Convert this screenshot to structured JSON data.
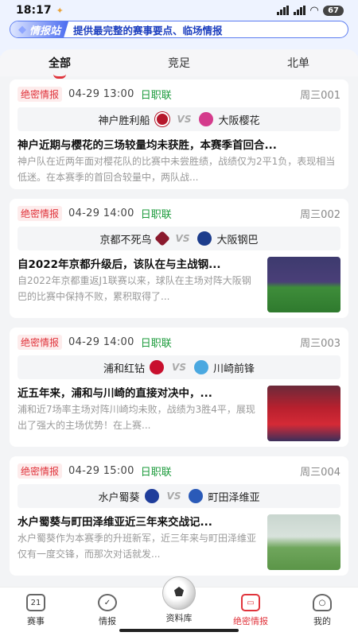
{
  "status": {
    "time": "18:17",
    "battery": "67"
  },
  "banner": {
    "badge": "情报站",
    "text": "提供最完整的赛事要点、临场情报"
  },
  "tabs": [
    "全部",
    "竞足",
    "北单"
  ],
  "colors": {
    "accent": "#e0343c",
    "league": "#1a9a3a"
  },
  "cards": [
    {
      "tag": "绝密情报",
      "time": "04-29 13:00",
      "league": "日职联",
      "code": "周三001",
      "home": "神户胜利船",
      "away": "大阪樱花",
      "vs": "VS",
      "title": "神户近期与樱花的三场较量均未获胜，本赛季首回合...",
      "desc": "神户队在近两年面对樱花队的比赛中未尝胜绩，战绩仅为2平1负，表现相当低迷。在本赛季的首回合较量中，两队战..."
    },
    {
      "tag": "绝密情报",
      "time": "04-29 14:00",
      "league": "日职联",
      "code": "周三002",
      "home": "京都不死鸟",
      "away": "大阪钢巴",
      "vs": "VS",
      "title": "自2022年京都升级后，该队在与主战钢...",
      "desc": "自2022年京都重返J1联赛以来，球队在主场对阵大阪钢巴的比赛中保持不败，累积取得了..."
    },
    {
      "tag": "绝密情报",
      "time": "04-29 14:00",
      "league": "日职联",
      "code": "周三003",
      "home": "浦和红钻",
      "away": "川崎前锋",
      "vs": "VS",
      "title": "近五年来，浦和与川崎的直接对决中，...",
      "desc": "浦和近7场率主场对阵川崎均未败，战绩为3胜4平，展现出了强大的主场优势！在上赛..."
    },
    {
      "tag": "绝密情报",
      "time": "04-29 15:00",
      "league": "日职联",
      "code": "周三004",
      "home": "水户蜀葵",
      "away": "町田泽维亚",
      "vs": "VS",
      "title": "水户蜀葵与町田泽维亚近三年来交战记...",
      "desc": "水户蜀葵作为本赛季的升班新军，近三年来与町田泽维亚仅有一度交锋，而那次对话就发..."
    }
  ],
  "nav": [
    "赛事",
    "情报",
    "资料库",
    "绝密情报",
    "我的"
  ]
}
